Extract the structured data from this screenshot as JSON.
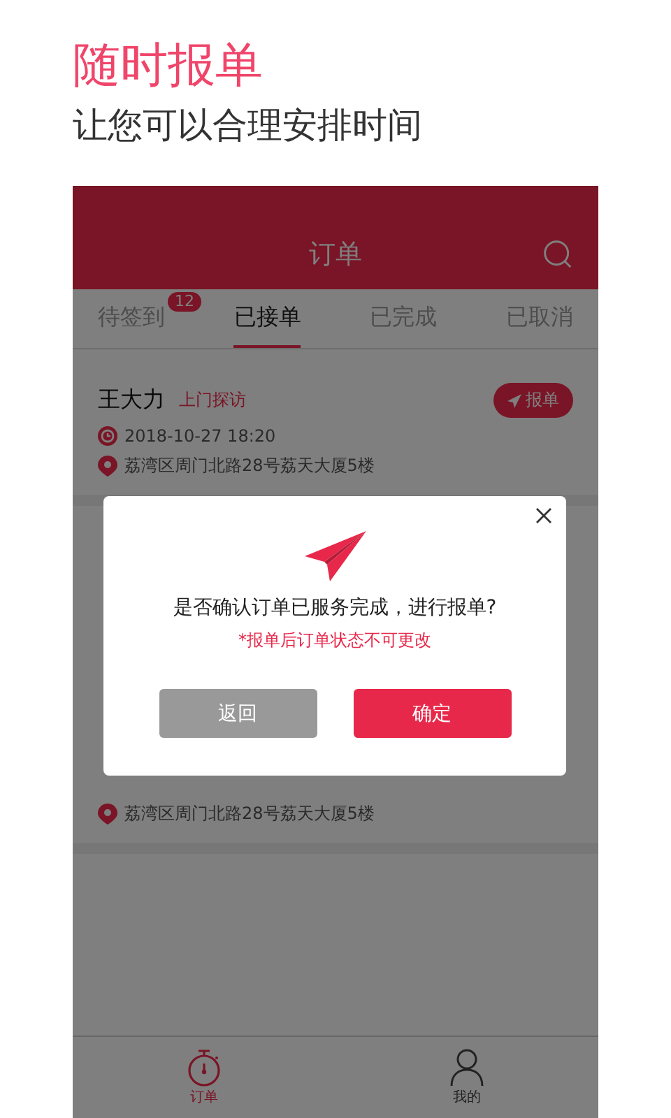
{
  "headline": "随时报单",
  "subheadline": "让您可以合理安排时间",
  "navbar": {
    "title": "订单"
  },
  "tabs": [
    {
      "label": "待签到",
      "badge": "12",
      "selected": false
    },
    {
      "label": "已接单",
      "selected": true
    },
    {
      "label": "已完成",
      "selected": false
    },
    {
      "label": "已取消",
      "selected": false
    }
  ],
  "orders": [
    {
      "name": "王大力",
      "tag": "上门探访",
      "time": "2018-10-27 18:20",
      "address": "荔湾区周门北路28号荔天大厦5楼",
      "button": "报单"
    },
    {
      "address": "荔湾区周门北路28号荔天大厦5楼"
    }
  ],
  "dialog": {
    "message": "是否确认订单已服务完成，进行报单?",
    "note": "*报单后订单状态不可更改",
    "buttons": [
      {
        "label": "返回",
        "kind": "secondary"
      },
      {
        "label": "确定",
        "kind": "primary"
      }
    ]
  },
  "bottom_tabs": [
    {
      "label": "订单",
      "kind": "orders",
      "selected": true
    },
    {
      "label": "我的",
      "kind": "profile",
      "selected": false
    }
  ]
}
